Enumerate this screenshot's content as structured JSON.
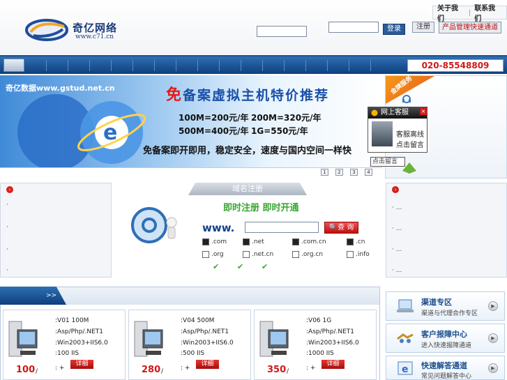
{
  "header": {
    "brand_name": "奇亿网络",
    "brand_url": "www.c71.cn",
    "top_links": [
      "关于我们",
      "联系我们"
    ],
    "login_label": "登录",
    "register_label": "注册",
    "product_link": "产品管理快速通道"
  },
  "nav": {
    "phone": "020-85548809"
  },
  "banner": {
    "brand": "奇亿数据www.gstud.net.cn",
    "headline_big": "免",
    "headline_rest": "备案虚拟主机特价推荐",
    "prices": [
      "100M=200元/年",
      "200M=320元/年",
      "500M=400元/年",
      "1G=550元/年"
    ],
    "tagline": "免备案即开即用，稳定安全，速度与国内空间一样快",
    "pages": [
      "1",
      "2",
      "3",
      "4"
    ]
  },
  "promo": {
    "ribbon": "金牌服务"
  },
  "chat": {
    "title": "网上客服",
    "close": "×",
    "line1": "客服离线",
    "line2": "点击留言",
    "tip": "点击留言"
  },
  "domain": {
    "tab": "域名注册",
    "title": "即时注册   即时开通",
    "www": "www.",
    "search_label": "查 询",
    "tlds": [
      {
        "name": ".com",
        "checked": true
      },
      {
        "name": ".net",
        "checked": true
      },
      {
        "name": ".com.cn",
        "checked": true
      },
      {
        "name": ".cn",
        "checked": true
      },
      {
        "name": ".org",
        "checked": false
      },
      {
        "name": ".net.cn",
        "checked": false
      },
      {
        "name": ".org.cn",
        "checked": false
      },
      {
        "name": ".info",
        "checked": false
      }
    ],
    "tick": "✔",
    "left_items": [
      "·",
      "·",
      "·",
      "·"
    ],
    "right_items": [
      "·    ...",
      "·    ...",
      "·    ...",
      "·    ..."
    ]
  },
  "plans": {
    "tab_text": ">>",
    "cards": [
      {
        "id": ":V01   100M",
        "lang": ":Asp/Php/.NET1",
        "os": ":Win2003+IIS6.0",
        "iis": ":100 IIS",
        "price": "100",
        "per": "/",
        "extra": ": +",
        "detail": "详细"
      },
      {
        "id": ":V04   500M",
        "lang": ":Asp/Php/.NET1",
        "os": ":Win2003+IIS6.0",
        "iis": ":500 IIS",
        "price": "280",
        "per": "/",
        "extra": ": +",
        "detail": "详细"
      },
      {
        "id": ":V06   1G",
        "lang": ":Asp/Php/.NET1",
        "os": ":Win2003+IIS6.0",
        "iis": ":1000 IIS",
        "price": "350",
        "per": "/",
        "extra": ": +",
        "detail": "详细"
      }
    ]
  },
  "services": [
    {
      "title": "渠道专区",
      "sub": "渠道与代理合作专区"
    },
    {
      "title": "客户报障中心",
      "sub": "进入快速报障通道"
    },
    {
      "title": "快速解答通道",
      "sub": "常见问题解答中心"
    }
  ]
}
